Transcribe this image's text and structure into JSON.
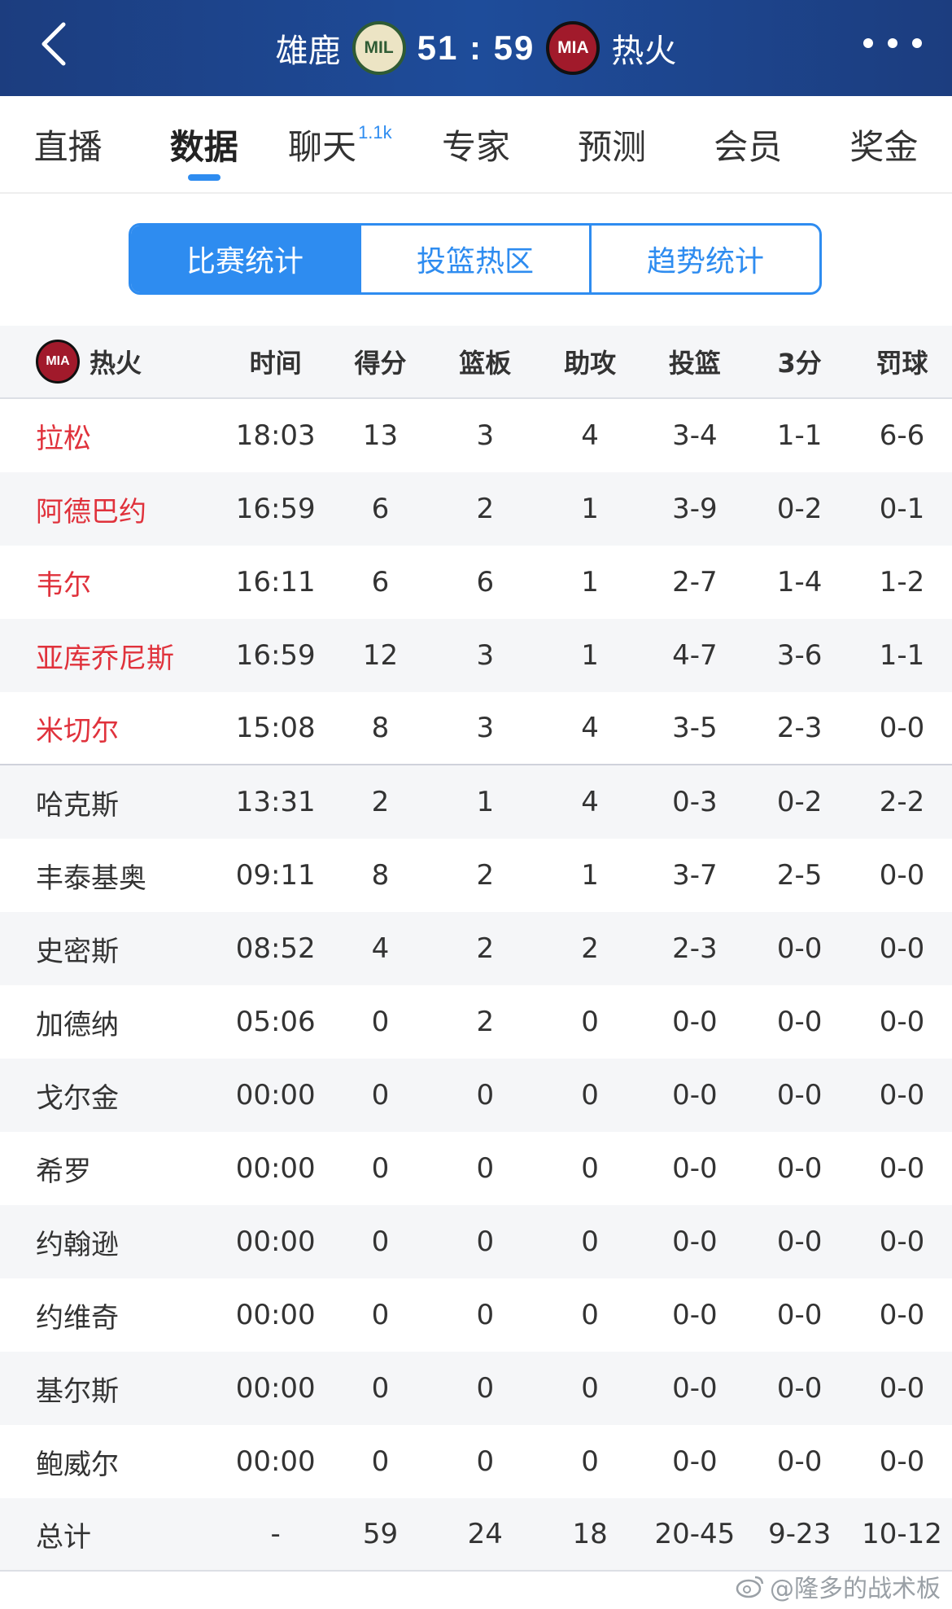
{
  "header": {
    "home_team": "雄鹿",
    "home_logo": "MIL",
    "away_team": "热火",
    "away_logo": "MIA",
    "score": "51 : 59"
  },
  "tabs": [
    {
      "label": "直播"
    },
    {
      "label": "数据",
      "active": true
    },
    {
      "label": "聊天",
      "badge": "1.1k"
    },
    {
      "label": "专家"
    },
    {
      "label": "预测"
    },
    {
      "label": "会员"
    },
    {
      "label": "奖金"
    }
  ],
  "segment": [
    "比赛统计",
    "投篮热区",
    "趋势统计"
  ],
  "table": {
    "team_logo": "MIA",
    "team_name": "热火",
    "columns": [
      "时间",
      "得分",
      "篮板",
      "助攻",
      "投篮",
      "3分",
      "罚球"
    ],
    "rows": [
      [
        "拉松",
        "18:03",
        "13",
        "3",
        "4",
        "3-4",
        "1-1",
        "6-6"
      ],
      [
        "阿德巴约",
        "16:59",
        "6",
        "2",
        "1",
        "3-9",
        "0-2",
        "0-1"
      ],
      [
        "韦尔",
        "16:11",
        "6",
        "6",
        "1",
        "2-7",
        "1-4",
        "1-2"
      ],
      [
        "亚库乔尼斯",
        "16:59",
        "12",
        "3",
        "1",
        "4-7",
        "3-6",
        "1-1"
      ],
      [
        "米切尔",
        "15:08",
        "8",
        "3",
        "4",
        "3-5",
        "2-3",
        "0-0"
      ],
      [
        "哈克斯",
        "13:31",
        "2",
        "1",
        "4",
        "0-3",
        "0-2",
        "2-2"
      ],
      [
        "丰泰基奥",
        "09:11",
        "8",
        "2",
        "1",
        "3-7",
        "2-5",
        "0-0"
      ],
      [
        "史密斯",
        "08:52",
        "4",
        "2",
        "2",
        "2-3",
        "0-0",
        "0-0"
      ],
      [
        "加德纳",
        "05:06",
        "0",
        "2",
        "0",
        "0-0",
        "0-0",
        "0-0"
      ],
      [
        "戈尔金",
        "00:00",
        "0",
        "0",
        "0",
        "0-0",
        "0-0",
        "0-0"
      ],
      [
        "希罗",
        "00:00",
        "0",
        "0",
        "0",
        "0-0",
        "0-0",
        "0-0"
      ],
      [
        "约翰逊",
        "00:00",
        "0",
        "0",
        "0",
        "0-0",
        "0-0",
        "0-0"
      ],
      [
        "约维奇",
        "00:00",
        "0",
        "0",
        "0",
        "0-0",
        "0-0",
        "0-0"
      ],
      [
        "基尔斯",
        "00:00",
        "0",
        "0",
        "0",
        "0-0",
        "0-0",
        "0-0"
      ],
      [
        "鲍威尔",
        "00:00",
        "0",
        "0",
        "0",
        "0-0",
        "0-0",
        "0-0"
      ]
    ],
    "starters_count": 5,
    "total": [
      "总计",
      "-",
      "59",
      "24",
      "18",
      "20-45",
      "9-23",
      "10-12"
    ]
  },
  "watermark": "@隆多的战术板",
  "colors": {
    "header_bg": "#1e4c9a",
    "accent": "#2e8cf0",
    "starter_name": "#e0323c",
    "row_alt": "#f5f6f8"
  },
  "icons": {
    "back": "chevron-left-icon",
    "more": "more-dots-icon",
    "watermark": "weibo-icon"
  }
}
